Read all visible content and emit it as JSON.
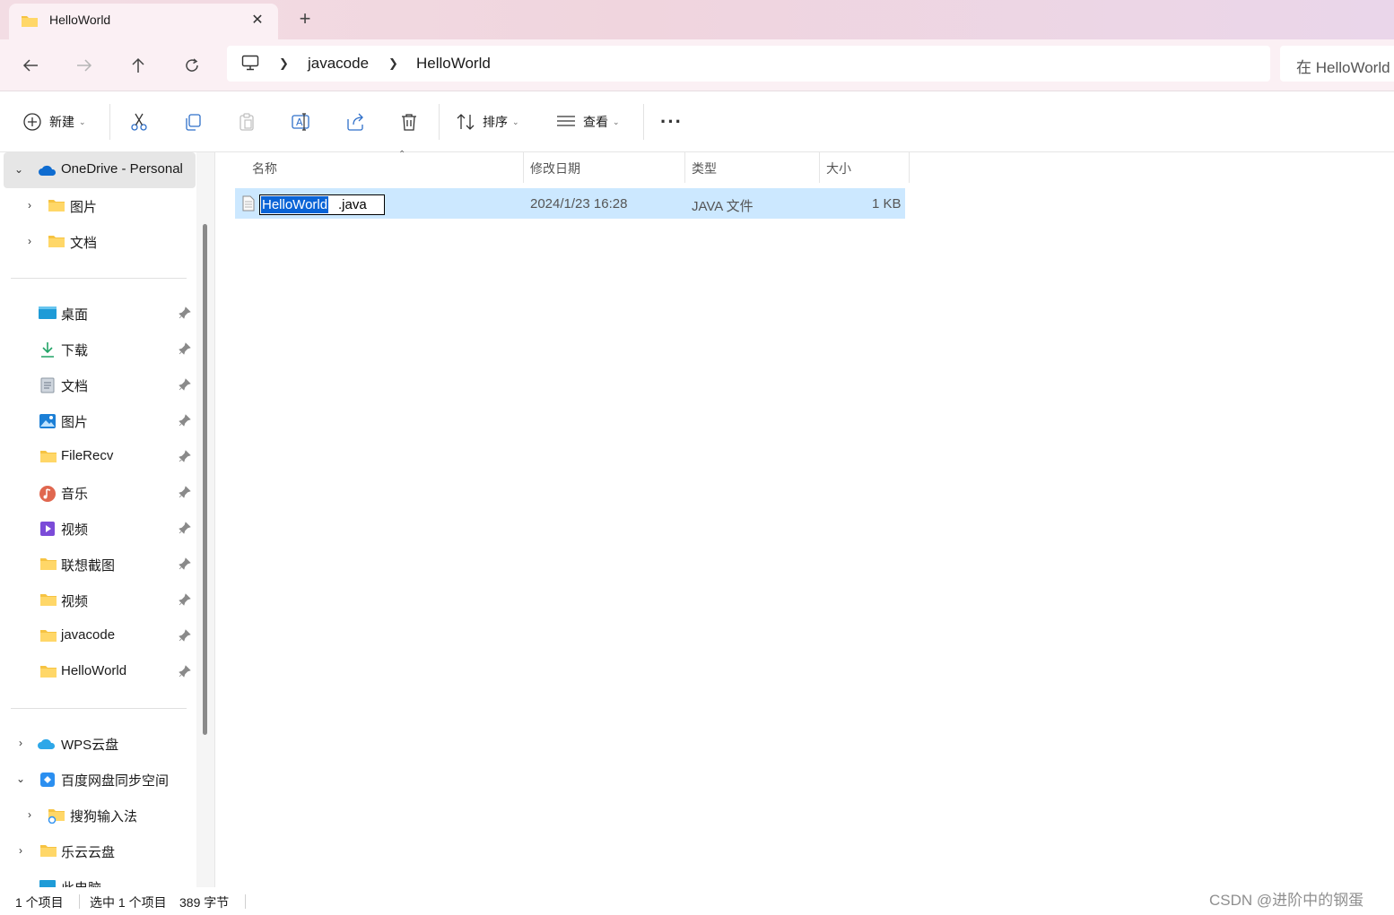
{
  "tab": {
    "title": "HelloWorld",
    "close": "✕",
    "new": "+"
  },
  "navigation": {
    "breadcrumb": [
      "javacode",
      "HelloWorld"
    ],
    "search_placeholder": "在 HelloWorld 中搜索"
  },
  "toolbar": {
    "new_label": "新建",
    "sort_label": "排序",
    "view_label": "查看",
    "more_label": "···"
  },
  "sidebar": {
    "onedrive": "OneDrive - Personal",
    "onedrive_children": [
      "图片",
      "文档"
    ],
    "quick_access": [
      "桌面",
      "下载",
      "文档",
      "图片",
      "FileRecv",
      "音乐",
      "视频",
      "联想截图",
      "视频",
      "javacode",
      "HelloWorld"
    ],
    "locations": [
      "WPS云盘",
      "百度网盘同步空间",
      "搜狗输入法",
      "乐云云盘",
      "此电脑"
    ]
  },
  "columns": [
    "名称",
    "修改日期",
    "类型",
    "大小"
  ],
  "files": [
    {
      "name_selected": "HelloWorld",
      "name_rest": ".java",
      "modified": "2024/1/23 16:28",
      "type": "JAVA 文件",
      "size": "1 KB"
    }
  ],
  "status": {
    "count": "1 个项目",
    "selected": "选中 1 个项目",
    "bytes": "389 字节"
  },
  "watermark": "CSDN @进阶中的钢蛋",
  "colors": {
    "accent": "#0a64d6",
    "selection": "#cce8ff",
    "titlebar": "#f3dde4"
  }
}
